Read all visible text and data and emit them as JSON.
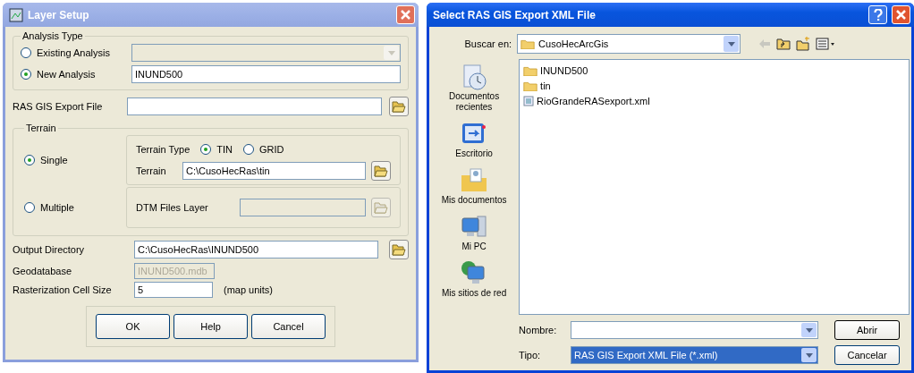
{
  "layer_setup": {
    "window": {
      "title": "Layer Setup",
      "active": false
    },
    "analysis_type": {
      "title": "Analysis Type",
      "options": [
        {
          "label": "Existing Analysis",
          "selected": false,
          "field": {
            "disabled": true,
            "kind": "dropdown"
          }
        },
        {
          "label": "New Analysis",
          "selected": true,
          "field": {
            "value": "INUND500",
            "disabled": false,
            "kind": "text"
          }
        }
      ]
    },
    "export_file": {
      "label": "RAS GIS Export File"
    },
    "terrain": {
      "title": "Terrain",
      "modes": [
        {
          "label": "Single",
          "selected": true
        },
        {
          "label": "Multiple",
          "selected": false
        }
      ],
      "terrain_type": {
        "label": "Terrain Type",
        "options": [
          {
            "label": "TIN",
            "selected": true
          },
          {
            "label": "GRID",
            "selected": false
          }
        ]
      },
      "terrain_field": {
        "label": "Terrain",
        "value": "C:\\CusoHecRas\\tin",
        "disabled": false
      },
      "dtm_field": {
        "label": "DTM Files Layer",
        "disabled": true
      }
    },
    "output_directory": {
      "label": "Output Directory",
      "value": "C:\\CusoHecRas\\INUND500"
    },
    "geodatabase": {
      "label": "Geodatabase",
      "value": "INUND500.mdb",
      "disabled": true
    },
    "cell_size": {
      "label": "Rasterization Cell Size",
      "value": "5",
      "unit": "(map units)"
    },
    "buttons": [
      "OK",
      "Help",
      "Cancel"
    ]
  },
  "file_dialog": {
    "window": {
      "title": "Select RAS GIS Export XML File",
      "active": true
    },
    "look_in": {
      "label": "Buscar en:",
      "value": "CusoHecArcGis"
    },
    "places": [
      {
        "label": "Documentos recientes",
        "kind": "recent"
      },
      {
        "label": "Escritorio",
        "kind": "desktop"
      },
      {
        "label": "Mis documentos",
        "kind": "documents"
      },
      {
        "label": "Mi PC",
        "kind": "computer"
      },
      {
        "label": "Mis sitios de red",
        "kind": "network"
      }
    ],
    "files": [
      {
        "name": "INUND500",
        "kind": "folder"
      },
      {
        "name": "tin",
        "kind": "folder"
      },
      {
        "name": "RioGrandeRASexport.xml",
        "kind": "xml"
      }
    ],
    "name_field": {
      "label": "Nombre:",
      "selected": false
    },
    "type_field": {
      "label": "Tipo:",
      "value": "RAS GIS Export XML File (*.xml)",
      "selected": true
    },
    "buttons": [
      "Abrir",
      "Cancelar"
    ]
  }
}
